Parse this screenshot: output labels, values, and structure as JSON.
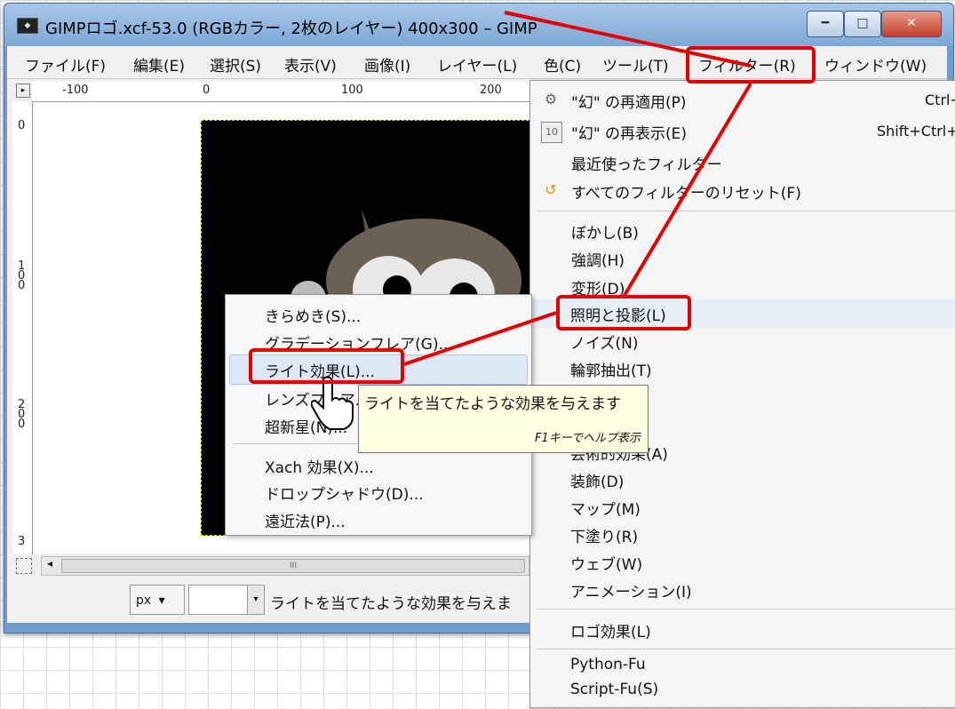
{
  "window": {
    "title": "GIMPロゴ.xcf-53.0 (RGBカラー, 2枚のレイヤー) 400x300 – GIMP",
    "app_icon": "wilber-icon",
    "minimize": "━",
    "maximize": "□",
    "close": "✕"
  },
  "menubar": [
    "ファイル(F)",
    "編集(E)",
    "選択(S)",
    "表示(V)",
    "画像(I)",
    "レイヤー(L)",
    "色(C)",
    "ツール(T)",
    "フィルター(R)",
    "ウィンドウ(W)"
  ],
  "rulers": {
    "top": [
      "-100",
      "0",
      "100",
      "200"
    ],
    "left": [
      "0",
      "1\n0\n0",
      "2\n0\n0",
      "3"
    ]
  },
  "scrollbar": {
    "left_arrow": "◂",
    "thumb": "III"
  },
  "statusbar": {
    "unit": "px",
    "unit_arrow": "▾",
    "zoom_arrow": "▾",
    "message": "ライトを当てたような効果を与えま"
  },
  "filter_menu": {
    "items": [
      {
        "label": "\"幻\" の再適用(P)",
        "shortcut": "Ctrl+",
        "icon": "reapply-icon"
      },
      {
        "label": "\"幻\" の再表示(E)",
        "shortcut": "Shift+Ctrl+",
        "icon": "reshow-icon"
      },
      {
        "label": "最近使ったフィルター",
        "shortcut": "",
        "icon": ""
      },
      {
        "label": "すべてのフィルターのリセット(F)",
        "shortcut": "",
        "icon": "reset-icon"
      },
      {
        "label": "ぼかし(B)"
      },
      {
        "label": "強調(H)"
      },
      {
        "label": "変形(D)"
      },
      {
        "label": "照明と投影(L)"
      },
      {
        "label": "ノイズ(N)"
      },
      {
        "label": "輪郭抽出(T)"
      },
      {
        "label": "芸術的効果(A)"
      },
      {
        "label": "装飾(D)"
      },
      {
        "label": "マップ(M)"
      },
      {
        "label": "下塗り(R)"
      },
      {
        "label": "ウェブ(W)"
      },
      {
        "label": "アニメーション(I)"
      },
      {
        "label": "ロゴ効果(L)"
      },
      {
        "label": "Python-Fu"
      },
      {
        "label": "Script-Fu(S)"
      }
    ]
  },
  "submenu": {
    "items": [
      "きらめき(S)...",
      "グラデーションフレア(G)...",
      "ライト効果(L)...",
      "レンズフレア...",
      "超新星(N)...",
      "Xach 効果(X)...",
      "ドロップシャドウ(D)...",
      "遠近法(P)..."
    ]
  },
  "tooltip": {
    "text": "ライトを当てたような効果を与えます",
    "help": "F1キーでヘルプ表示"
  },
  "annotation_color": "#e30000"
}
